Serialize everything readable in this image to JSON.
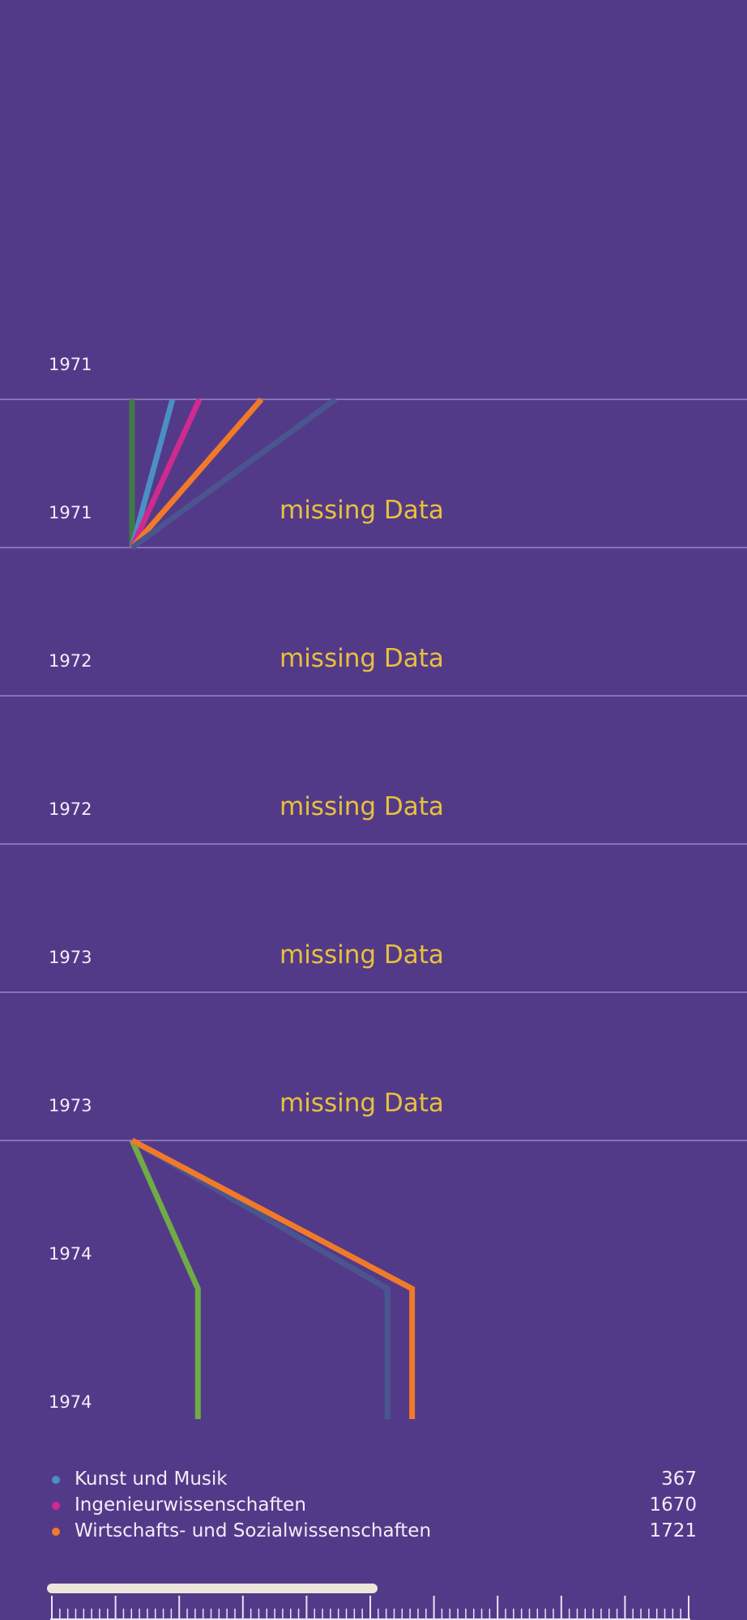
{
  "chart_data": {
    "type": "line",
    "rows": [
      {
        "label": "1971",
        "missing": ""
      },
      {
        "label": "1971",
        "missing": "missing Data"
      },
      {
        "label": "1972",
        "missing": "missing Data"
      },
      {
        "label": "1972",
        "missing": "missing Data"
      },
      {
        "label": "1973",
        "missing": "missing Data"
      },
      {
        "label": "1973",
        "missing": "missing Data"
      },
      {
        "label": "1974",
        "missing": ""
      },
      {
        "label": "1974",
        "missing": ""
      }
    ],
    "series": [
      {
        "color": "#3f7a45",
        "values": [
          0,
          0
        ]
      },
      {
        "color": "#4b8fc4",
        "values": [
          312,
          0
        ]
      },
      {
        "color": "#cf2a8e",
        "values": [
          520,
          0
        ]
      },
      {
        "color": "#f07a2a",
        "values": [
          998,
          0
        ]
      },
      {
        "color": "#4a5590",
        "values": [
          1570,
          0
        ]
      },
      {
        "color": "#6fac45",
        "values": [
          0,
          508,
          508
        ]
      },
      {
        "color": "#4a5590",
        "values": [
          0,
          1970,
          1970
        ]
      },
      {
        "color": "#f07a2a",
        "values": [
          0,
          2160,
          2160
        ]
      }
    ],
    "legend": [
      {
        "label": "Kunst und Musik",
        "value": "367",
        "color": "#4b8fc4"
      },
      {
        "label": "Ingenieurwissenschaften",
        "value": "1670",
        "color": "#cf2a8e"
      },
      {
        "label": "Wirtschafts- und Sozialwissenschaften",
        "value": "1721",
        "color": "#f07a2a"
      }
    ],
    "grid": true
  },
  "scrollbar": {
    "position": 0.6
  }
}
